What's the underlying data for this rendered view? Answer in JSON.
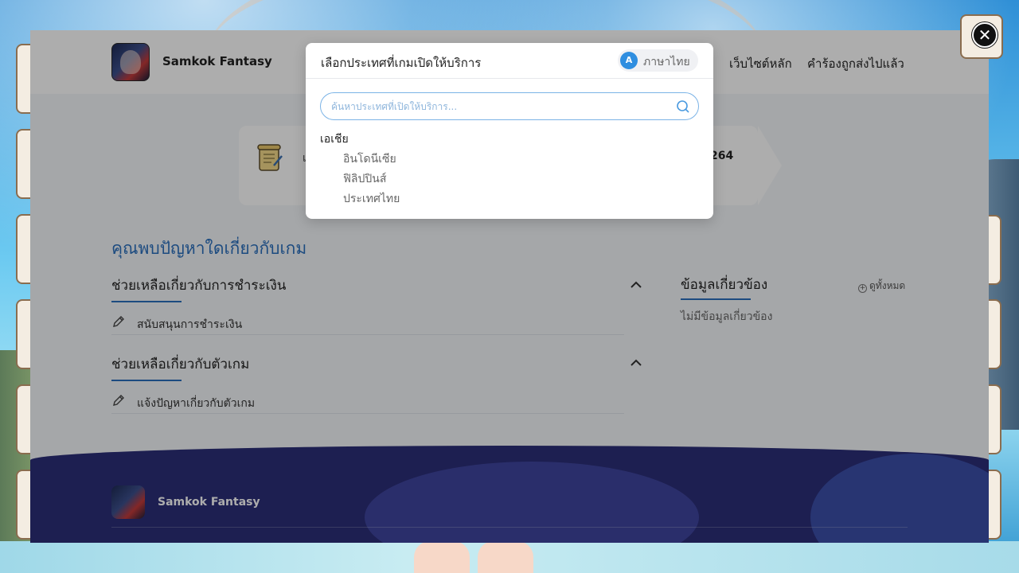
{
  "header": {
    "game_name": "Samkok Fantasy",
    "nav": {
      "main_site": "เว็บไซต์หลัก",
      "submitted_requests": "คำร้องถูกส่งไปแล้ว"
    }
  },
  "info_card": {
    "text": "เ",
    "number": "264"
  },
  "help": {
    "question_title": "คุณพบปัญหาใดเกี่ยวกับเกม",
    "sections": [
      {
        "title": "ช่วยเหลือเกี่ยวกับการชำระเงิน",
        "items": [
          "สนับสนุนการชำระเงิน"
        ]
      },
      {
        "title": "ช่วยเหลือเกี่ยวกับตัวเกม",
        "items": [
          "แจ้งปัญหาเกี่ยวกับตัวเกม"
        ]
      }
    ]
  },
  "related": {
    "title": "ข้อมูลเกี่ยวข้อง",
    "view_all": "ดูทั้งหมด",
    "empty": "ไม่มีข้อมูลเกี่ยวข้อง"
  },
  "footer": {
    "game_name": "Samkok Fantasy"
  },
  "modal": {
    "title": "เลือกประเทศที่เกมเปิดให้บริการ",
    "language": "ภาษาไทย",
    "search_placeholder": "ค้นหาประเทศที่เปิดให้บริการ...",
    "region": "เอเชีย",
    "countries": [
      "อินโดนีเซีย",
      "ฟิลิปปินส์",
      "ประเทศไทย"
    ]
  },
  "colors": {
    "accent": "#2a6fbd",
    "footer": "#2b2e78"
  }
}
